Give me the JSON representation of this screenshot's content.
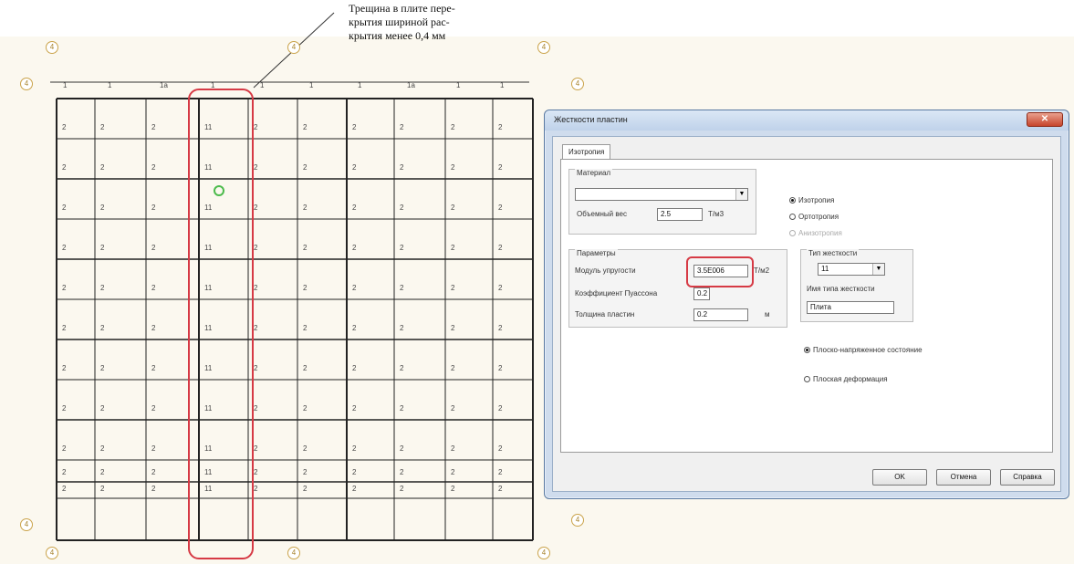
{
  "annotation": {
    "text": "Трещина в плите пере-\nкрытия шириной рас-\nкрытия менее 0,4 мм"
  },
  "plan": {
    "axis_marks": [
      "4",
      "4",
      "4",
      "4",
      "4",
      "4",
      "4",
      "4",
      "4",
      "4",
      "4"
    ],
    "top_labels": [
      "1",
      "1",
      "1а",
      "1",
      "1",
      "1",
      "1",
      "1а",
      "1",
      "1"
    ],
    "rows": [
      [
        "2",
        "2",
        "2",
        "11",
        "2",
        "2",
        "2",
        "2",
        "2",
        "2"
      ],
      [
        "2",
        "2",
        "2",
        "11",
        "2",
        "2",
        "2",
        "2",
        "2",
        "2"
      ],
      [
        "2",
        "2",
        "2",
        "11",
        "2",
        "2",
        "2",
        "2",
        "2",
        "2"
      ],
      [
        "2",
        "2",
        "2",
        "11",
        "2",
        "2",
        "2",
        "2",
        "2",
        "2"
      ],
      [
        "2",
        "2",
        "2",
        "11",
        "2",
        "2",
        "2",
        "2",
        "2",
        "2"
      ],
      [
        "2",
        "2",
        "2",
        "11",
        "2",
        "2",
        "2",
        "2",
        "2",
        "2"
      ],
      [
        "2",
        "2",
        "2",
        "11",
        "2",
        "2",
        "2",
        "2",
        "2",
        "2"
      ],
      [
        "2",
        "2",
        "2",
        "11",
        "2",
        "2",
        "2",
        "2",
        "2",
        "2"
      ],
      [
        "2",
        "2",
        "2",
        "11",
        "2",
        "2",
        "2",
        "2",
        "2",
        "2"
      ],
      [
        "2",
        "2",
        "2",
        "11",
        "2",
        "2",
        "2",
        "2",
        "2",
        "2"
      ],
      [
        "2",
        "2",
        "2",
        "11",
        "2",
        "2",
        "2",
        "2",
        "2",
        "2"
      ]
    ],
    "highlight_color": "#d63a45",
    "marker_color": "#4cbb4c"
  },
  "dialog": {
    "title": "Жесткости пластин",
    "close_label": "✕",
    "tab_label": "Изотропия",
    "material_group": "Материал",
    "material_value": "",
    "volume_weight_label": "Объемный вес",
    "volume_weight_value": "2.5",
    "volume_weight_unit": "Т/м3",
    "radio_isotropic": "Изотропия",
    "radio_orthotropic": "Ортотропия",
    "radio_anisotropic": "Анизотропия",
    "params_group": "Параметры",
    "modulus_label": "Модуль упругости",
    "modulus_value": "3.5E006",
    "modulus_unit": "Т/м2",
    "poisson_label": "Коэффициент Пуассона",
    "poisson_value": "0.2",
    "thickness_label": "Толщина пластин",
    "thickness_value": "0.2",
    "thickness_unit": "м",
    "stiffness_type_group": "Тип жесткости",
    "stiffness_type_value": "11",
    "stiffness_name_label": "Имя типа жесткости",
    "stiffness_name_value": "Плита",
    "radio_plane_stress": "Плоско-напряженное состояние",
    "radio_plane_strain": "Плоская деформация",
    "ok_label": "OK",
    "cancel_label": "Отмена",
    "help_label": "Справка",
    "accent": "#d63a45"
  }
}
